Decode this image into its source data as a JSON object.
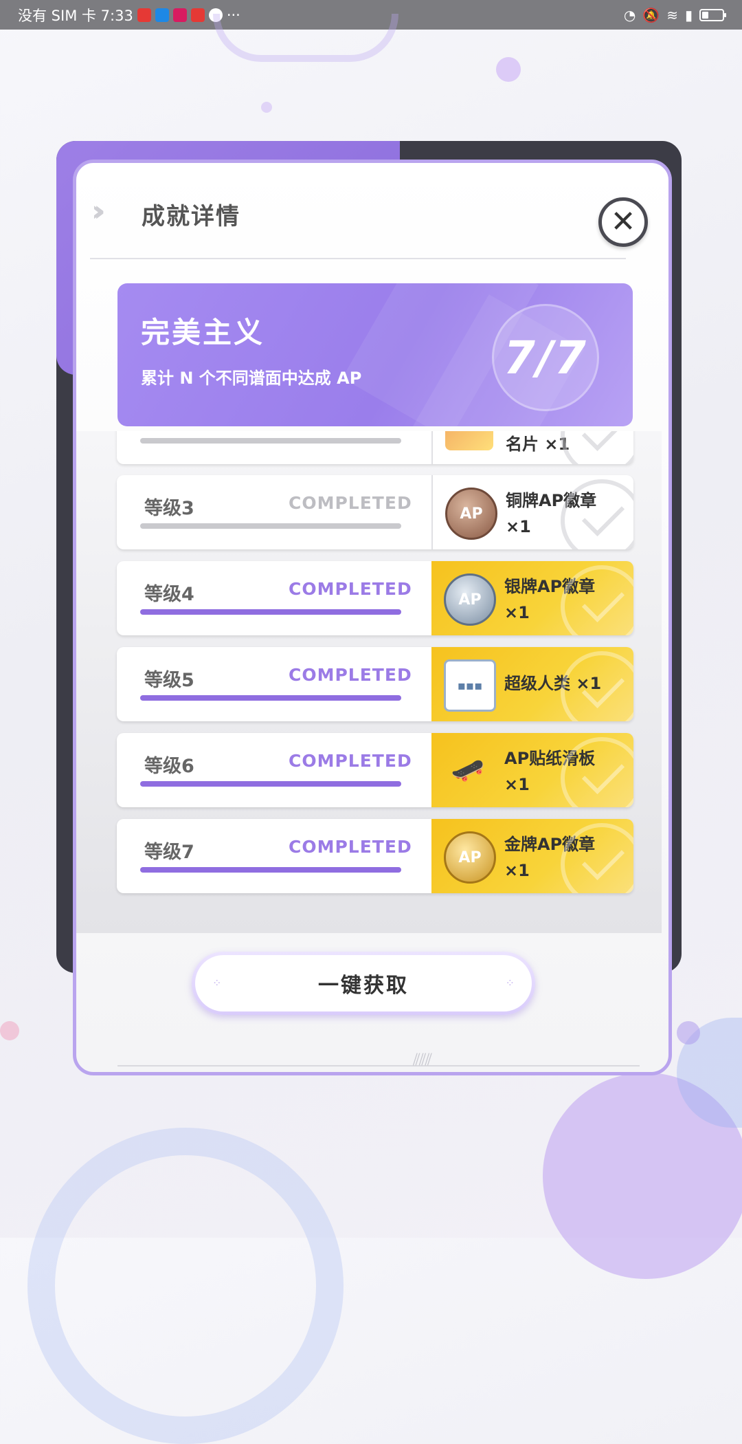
{
  "status_bar": {
    "carrier_time": "没有 SIM 卡 7:33",
    "more": "···"
  },
  "modal": {
    "title": "成就详情",
    "close_symbol": "✕",
    "achievement": {
      "name": "完美主义",
      "description": "累计 N 个不同谱面中达成 AP",
      "progress": "7/7"
    },
    "levels": [
      {
        "level": "",
        "status": "",
        "reward": "名片 ×1",
        "icon": "card-icon",
        "claimed": false
      },
      {
        "level": "等级3",
        "status": "COMPLETED",
        "reward": "铜牌AP徽章 ×1",
        "icon": "bronze-ap-badge-icon",
        "claimed": false
      },
      {
        "level": "等级4",
        "status": "COMPLETED",
        "reward": "银牌AP徽章 ×1",
        "icon": "silver-ap-badge-icon",
        "claimed": true
      },
      {
        "level": "等级5",
        "status": "COMPLETED",
        "reward": "超级人类 ×1",
        "icon": "calendar-icon",
        "claimed": true
      },
      {
        "level": "等级6",
        "status": "COMPLETED",
        "reward": "AP贴纸滑板 ×1",
        "icon": "skateboard-icon",
        "claimed": true
      },
      {
        "level": "等级7",
        "status": "COMPLETED",
        "reward": "金牌AP徽章 ×1",
        "icon": "gold-ap-badge-icon",
        "claimed": true
      }
    ],
    "claim_button": "一键获取"
  },
  "icon_text": {
    "ap": "AP",
    "cal": "▪▪▪",
    "skate": "🛹"
  },
  "colors": {
    "accent_purple": "#9a7eeb",
    "gold": "#f6c21e",
    "completed_text": "#9b7be6"
  }
}
